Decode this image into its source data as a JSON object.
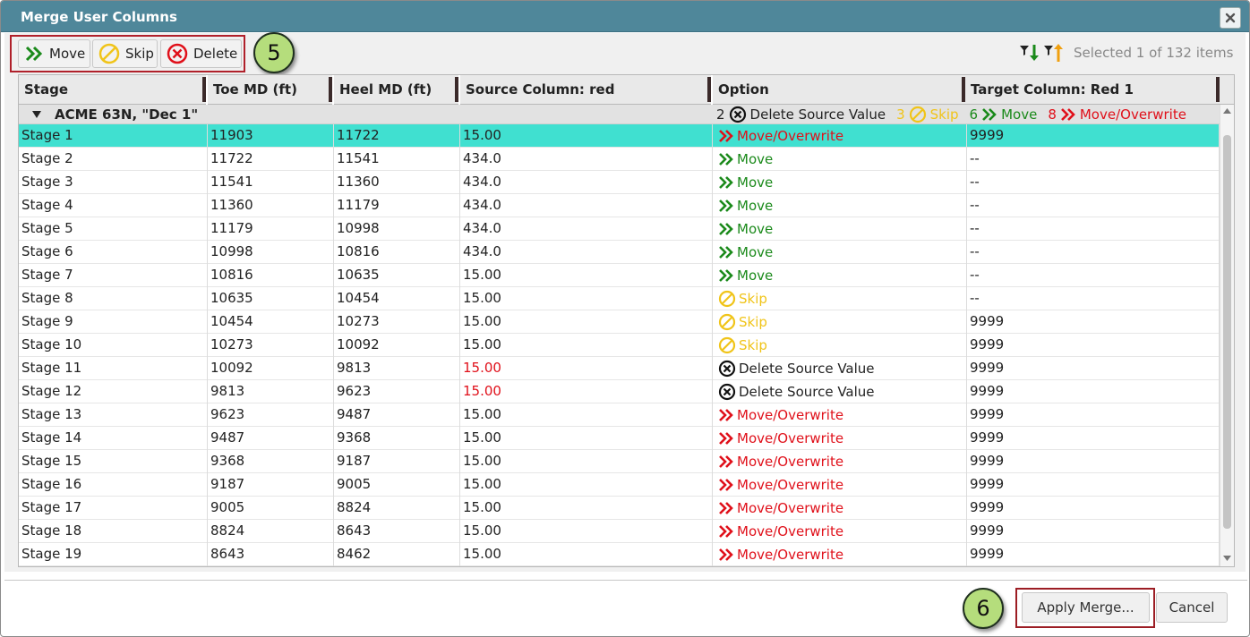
{
  "dialog": {
    "title": "Merge User Columns",
    "close_label": "✕"
  },
  "toolbar": {
    "move_label": "Move",
    "skip_label": "Skip",
    "delete_label": "Delete",
    "callout_5": "5",
    "selection_info": "Selected 1 of 132 items"
  },
  "columns": [
    "Stage",
    "Toe MD (ft)",
    "Heel MD (ft)",
    "Source Column: red",
    "Option",
    "Target Column: Red 1"
  ],
  "group": {
    "label": "ACME 63N, \"Dec 1\"",
    "summary": [
      {
        "count": "2",
        "label": "Delete Source Value",
        "kind": "delete"
      },
      {
        "count": "3",
        "label": "Skip",
        "kind": "skip"
      },
      {
        "count": "6",
        "label": "Move",
        "kind": "move"
      },
      {
        "count": "8",
        "label": "Move/Overwrite",
        "kind": "overwrite"
      }
    ]
  },
  "rows": [
    {
      "stage": "Stage 1",
      "toe": "11903",
      "heel": "11722",
      "source": "15.00",
      "option": "Move/Overwrite",
      "kind": "overwrite",
      "target": "9999",
      "selected": true
    },
    {
      "stage": "Stage 2",
      "toe": "11722",
      "heel": "11541",
      "source": "434.0",
      "option": "Move",
      "kind": "move",
      "target": "--"
    },
    {
      "stage": "Stage 3",
      "toe": "11541",
      "heel": "11360",
      "source": "434.0",
      "option": "Move",
      "kind": "move",
      "target": "--"
    },
    {
      "stage": "Stage 4",
      "toe": "11360",
      "heel": "11179",
      "source": "434.0",
      "option": "Move",
      "kind": "move",
      "target": "--"
    },
    {
      "stage": "Stage 5",
      "toe": "11179",
      "heel": "10998",
      "source": "434.0",
      "option": "Move",
      "kind": "move",
      "target": "--"
    },
    {
      "stage": "Stage 6",
      "toe": "10998",
      "heel": "10816",
      "source": "434.0",
      "option": "Move",
      "kind": "move",
      "target": "--"
    },
    {
      "stage": "Stage 7",
      "toe": "10816",
      "heel": "10635",
      "source": "15.00",
      "option": "Move",
      "kind": "move",
      "target": "--"
    },
    {
      "stage": "Stage 8",
      "toe": "10635",
      "heel": "10454",
      "source": "15.00",
      "option": "Skip",
      "kind": "skip",
      "target": "--"
    },
    {
      "stage": "Stage 9",
      "toe": "10454",
      "heel": "10273",
      "source": "15.00",
      "option": "Skip",
      "kind": "skip",
      "target": "9999"
    },
    {
      "stage": "Stage 10",
      "toe": "10273",
      "heel": "10092",
      "source": "15.00",
      "option": "Skip",
      "kind": "skip",
      "target": "9999"
    },
    {
      "stage": "Stage 11",
      "toe": "10092",
      "heel": "9813",
      "source": "15.00",
      "option": "Delete Source Value",
      "kind": "delete",
      "target": "9999",
      "source_red": true
    },
    {
      "stage": "Stage 12",
      "toe": "9813",
      "heel": "9623",
      "source": "15.00",
      "option": "Delete Source Value",
      "kind": "delete",
      "target": "9999",
      "source_red": true
    },
    {
      "stage": "Stage 13",
      "toe": "9623",
      "heel": "9487",
      "source": "15.00",
      "option": "Move/Overwrite",
      "kind": "overwrite",
      "target": "9999"
    },
    {
      "stage": "Stage 14",
      "toe": "9487",
      "heel": "9368",
      "source": "15.00",
      "option": "Move/Overwrite",
      "kind": "overwrite",
      "target": "9999"
    },
    {
      "stage": "Stage 15",
      "toe": "9368",
      "heel": "9187",
      "source": "15.00",
      "option": "Move/Overwrite",
      "kind": "overwrite",
      "target": "9999"
    },
    {
      "stage": "Stage 16",
      "toe": "9187",
      "heel": "9005",
      "source": "15.00",
      "option": "Move/Overwrite",
      "kind": "overwrite",
      "target": "9999"
    },
    {
      "stage": "Stage 17",
      "toe": "9005",
      "heel": "8824",
      "source": "15.00",
      "option": "Move/Overwrite",
      "kind": "overwrite",
      "target": "9999"
    },
    {
      "stage": "Stage 18",
      "toe": "8824",
      "heel": "8643",
      "source": "15.00",
      "option": "Move/Overwrite",
      "kind": "overwrite",
      "target": "9999"
    },
    {
      "stage": "Stage 19",
      "toe": "8643",
      "heel": "8462",
      "source": "15.00",
      "option": "Move/Overwrite",
      "kind": "overwrite",
      "target": "9999"
    }
  ],
  "footer": {
    "apply_label": "Apply Merge...",
    "cancel_label": "Cancel",
    "callout_6": "6"
  },
  "colors": {
    "titlebar": "#4f879a",
    "selected_row": "#40e0d0",
    "overwrite": "#e0101a",
    "move": "#1b8a1b",
    "skip": "#f0c419",
    "callout": "#b5dd7c"
  }
}
